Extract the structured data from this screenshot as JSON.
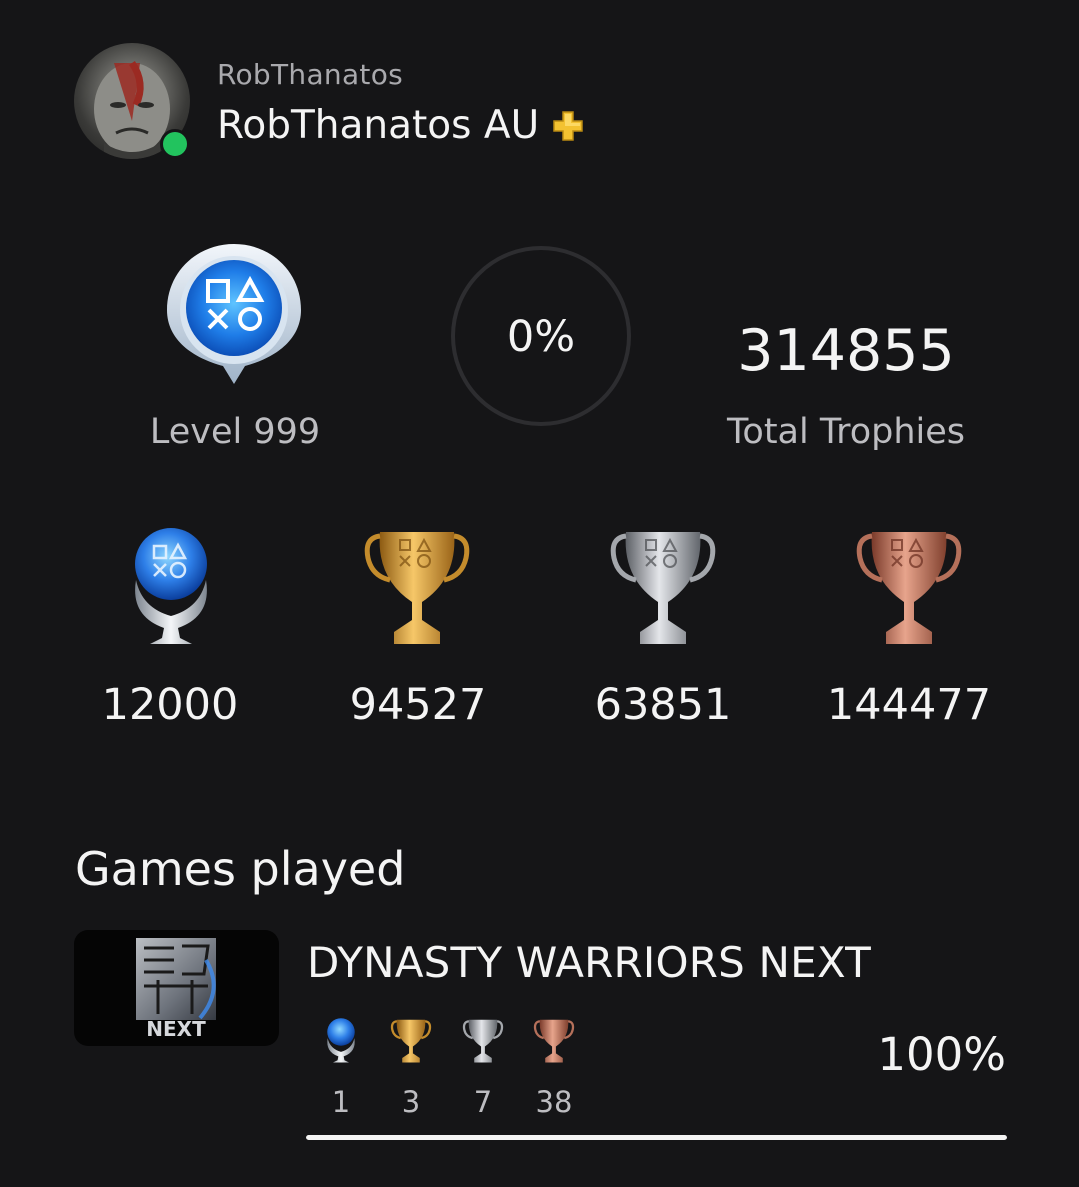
{
  "profile": {
    "online_id": "RobThanatos",
    "display_name": "RobThanatos AU",
    "status": "online",
    "subscription_icon": "playstation-plus-icon"
  },
  "stats": {
    "level_label": "Level 999",
    "progress": "0%",
    "progress_fraction": 0,
    "total_trophies": "314855",
    "total_trophies_label": "Total Trophies"
  },
  "trophies": {
    "platinum": "12000",
    "gold": "94527",
    "silver": "63851",
    "bronze": "144477"
  },
  "colors": {
    "background": "#151517",
    "online": "#22c35e",
    "plus": "#f3c231",
    "platinum": "#2e7fe8",
    "gold": "#d69a2d",
    "silver": "#a9aaad",
    "bronze": "#b5705a"
  },
  "games_section": {
    "title": "Games played",
    "games": [
      {
        "title": "DYNASTY WARRIORS NEXT",
        "thumb_label": "NEXT",
        "platinum": "1",
        "gold": "3",
        "silver": "7",
        "bronze": "38",
        "progress": "100%",
        "progress_fraction": 1.0
      }
    ]
  }
}
